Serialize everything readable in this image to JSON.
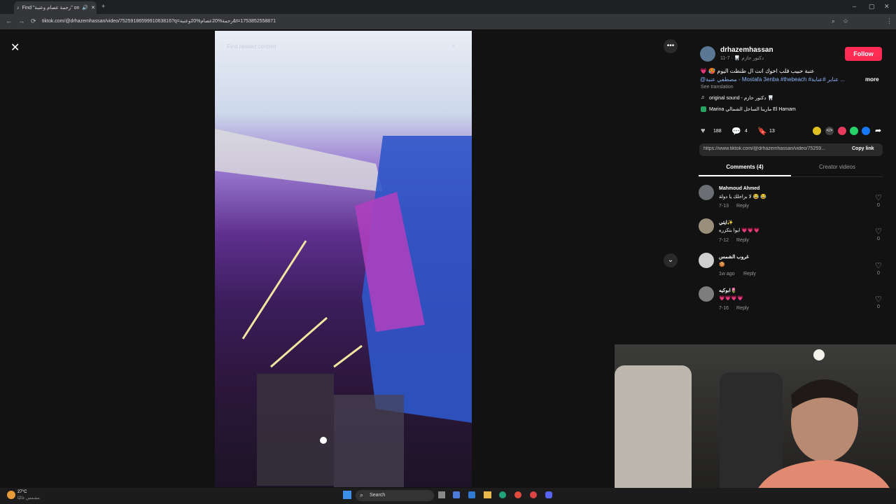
{
  "browser": {
    "tab_title": "Find \"رحمة عصام وعنبة\" on",
    "url": "tiktok.com/@drhazemhassan/video/7525918659991063816?q=رحمة%20عصام%20وعنبة&t=1753852558871"
  },
  "video": {
    "search_placeholder": "Find related content"
  },
  "author": {
    "username": "drhazemhassan",
    "subline": "دكتور حازم 🦷 · 7-11",
    "follow_label": "Follow"
  },
  "caption": {
    "line1": "عنبة حبيب قلب اخوك انت ال طنطت اليوم 🥵 💗",
    "line2": "@مصطفي عنبة - Mostafa 3enba #thebeach #عنابر #عنابة ...",
    "more_label": "more",
    "see_translation": "See translation",
    "sound": "original sound - دكتور حازم 🦷",
    "location": "Marina مارينا الساحل الشمالي El Hamam"
  },
  "stats": {
    "likes": "188",
    "comments": "4",
    "saves": "13"
  },
  "share": {
    "link": "https://www.tiktok.com/@drhazemhassan/video/75259...",
    "copy_label": "Copy link"
  },
  "tabs": {
    "comments": "Comments (4)",
    "creator": "Creator videos"
  },
  "comments": [
    {
      "name": "Mahmoud Ahmed",
      "text": "لا بزاحلك يا دولة 😂 😂",
      "date": "7-13",
      "reply": "Reply",
      "likes": "0"
    },
    {
      "name": "ايتي✨",
      "text": "ايوا بتكزره 💗💗💗",
      "date": "7-12",
      "reply": "Reply",
      "likes": "0"
    },
    {
      "name": "غروب الشمس",
      "text": "🍪",
      "date": "1w ago",
      "reply": "Reply",
      "likes": "0"
    },
    {
      "name": "ابوكيه🌷",
      "text": "💗💗💗💗",
      "date": "7-16",
      "reply": "Reply",
      "likes": "0"
    }
  ],
  "taskbar": {
    "temp": "27°C",
    "weather": "مشمس غالبًا",
    "search": "Search"
  },
  "colors": {
    "accent": "#fe2c55",
    "background": "#121212"
  }
}
